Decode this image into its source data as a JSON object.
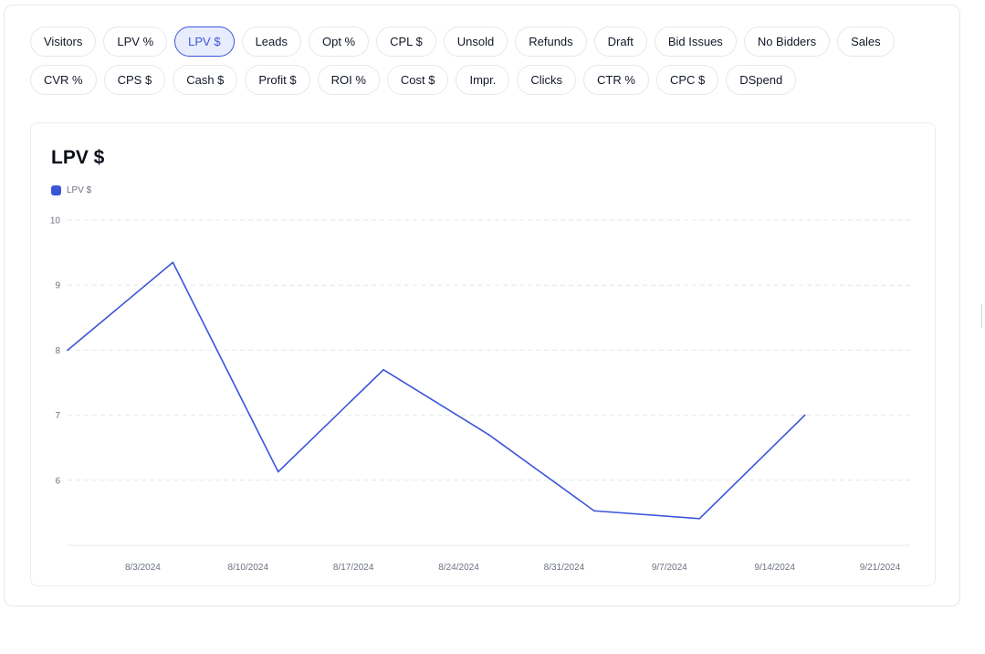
{
  "metric_chips": {
    "row1": [
      "Visitors",
      "LPV %",
      "LPV $",
      "Leads",
      "Opt %",
      "CPL $",
      "Unsold",
      "Refunds",
      "Draft",
      "Bid Issues",
      "No Bidders",
      "Sales"
    ],
    "row2": [
      "CVR %",
      "CPS $",
      "Cash $",
      "Profit $",
      "ROI %",
      "Cost $",
      "Impr.",
      "Clicks",
      "CTR %",
      "CPC $",
      "DSpend"
    ],
    "active": "LPV $"
  },
  "colors": {
    "accent": "#3b55d9",
    "active_chip_bg": "#e8edfd",
    "grid": "#e5e7eb",
    "axis_text": "#6b7280"
  },
  "chart_data": {
    "type": "line",
    "title": "LPV $",
    "legend": {
      "position": "top-left"
    },
    "grid": true,
    "x": [
      "7/29/2024",
      "8/5/2024",
      "8/12/2024",
      "8/19/2024",
      "8/26/2024",
      "9/2/2024",
      "9/9/2024",
      "9/16/2024",
      "9/23/2024"
    ],
    "x_ticks": [
      "8/3/2024",
      "8/10/2024",
      "8/17/2024",
      "8/24/2024",
      "8/31/2024",
      "9/7/2024",
      "9/14/2024",
      "9/21/2024"
    ],
    "series": [
      {
        "name": "LPV $",
        "color": "#3b55d9",
        "values": [
          8.0,
          9.35,
          6.13,
          7.7,
          6.7,
          5.53,
          5.41,
          7.0
        ]
      }
    ],
    "ylim": [
      5,
      10
    ],
    "y_ticks": [
      6,
      7,
      8,
      9,
      10
    ],
    "xlabel": "",
    "ylabel": ""
  }
}
